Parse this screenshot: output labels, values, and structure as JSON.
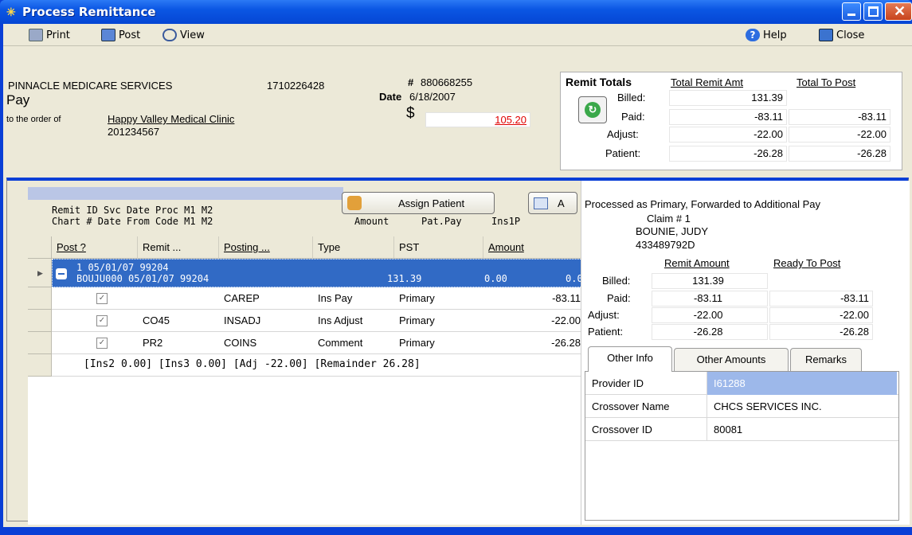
{
  "window": {
    "title": "Process Remittance"
  },
  "toolbar": {
    "print": "Print",
    "post": "Post",
    "view": "View",
    "help": "Help",
    "close": "Close"
  },
  "payer": {
    "name": "PINNACLE MEDICARE SERVICES",
    "id": "1710226428",
    "check_number_label": "#",
    "check_number": "880668255",
    "date_label": "Date",
    "date": "6/18/2007",
    "pay_label": "Pay",
    "order_label": "to the order of",
    "payee": "Happy Valley Medical Clinic",
    "payee_id": "201234567",
    "dollar_sign": "$",
    "amount": "105.20"
  },
  "remit_totals": {
    "title": "Remit Totals",
    "col_remit": "Total Remit Amt",
    "col_post": "Total To Post",
    "rows": [
      {
        "label": "Billed:",
        "remit": "131.39",
        "post": ""
      },
      {
        "label": "Paid:",
        "remit": "-83.11",
        "post": "-83.11"
      },
      {
        "label": "Adjust:",
        "remit": "-22.00",
        "post": "-22.00"
      },
      {
        "label": "Patient:",
        "remit": "-26.28",
        "post": "-26.28"
      }
    ]
  },
  "grid_header": {
    "line1": "Remit ID Svc Date  Proc M1 M2",
    "line2": "Chart #  Date From Code M1 M2",
    "amount": "Amount",
    "patpay": "Pat.Pay",
    "ins1": "Ins1P",
    "assign_button": "Assign Patient",
    "button2_fragment": "A"
  },
  "grid": {
    "columns": [
      "Post ?",
      "Remit ...",
      "Posting ...",
      "Type",
      "PST",
      "Amount"
    ],
    "group_row": {
      "line1": "1        05/01/07 99204",
      "line2": "BOUJU000 05/01/07 99204",
      "amount": "131.39",
      "patpay": "0.00",
      "ins": "0.0"
    },
    "rows": [
      {
        "checked": true,
        "remit": "",
        "posting": "CAREP",
        "type": "Ins Pay",
        "pst": "Primary",
        "amount": "-83.11"
      },
      {
        "checked": true,
        "remit": "CO45",
        "posting": "INSADJ",
        "type": "Ins Adjust",
        "pst": "Primary",
        "amount": "-22.00"
      },
      {
        "checked": true,
        "remit": "PR2",
        "posting": "COINS",
        "type": "Comment",
        "pst": "Primary",
        "amount": "-26.28"
      }
    ],
    "summary": "[Ins2 0.00] [Ins3 0.00] [Adj -22.00] [Remainder 26.28]"
  },
  "claim": {
    "status": "Processed as Primary, Forwarded to Additional Pay",
    "claim_no": "Claim # 1",
    "patient": "BOUNIE, JUDY",
    "member_id": "433489792D",
    "col_remit": "Remit Amount",
    "col_post": "Ready To Post",
    "rows": [
      {
        "label": "Billed:",
        "remit": "131.39",
        "post": ""
      },
      {
        "label": "Paid:",
        "remit": "-83.11",
        "post": "-83.11"
      },
      {
        "label": "Adjust:",
        "remit": "-22.00",
        "post": "-22.00"
      },
      {
        "label": "Patient:",
        "remit": "-26.28",
        "post": "-26.28"
      }
    ],
    "tabs": [
      "Other Info",
      "Other Amounts",
      "Remarks"
    ],
    "info": [
      {
        "key": "Provider ID",
        "value": "I61288"
      },
      {
        "key": "Crossover Name",
        "value": "CHCS SERVICES INC."
      },
      {
        "key": "Crossover ID",
        "value": "80081"
      }
    ]
  }
}
